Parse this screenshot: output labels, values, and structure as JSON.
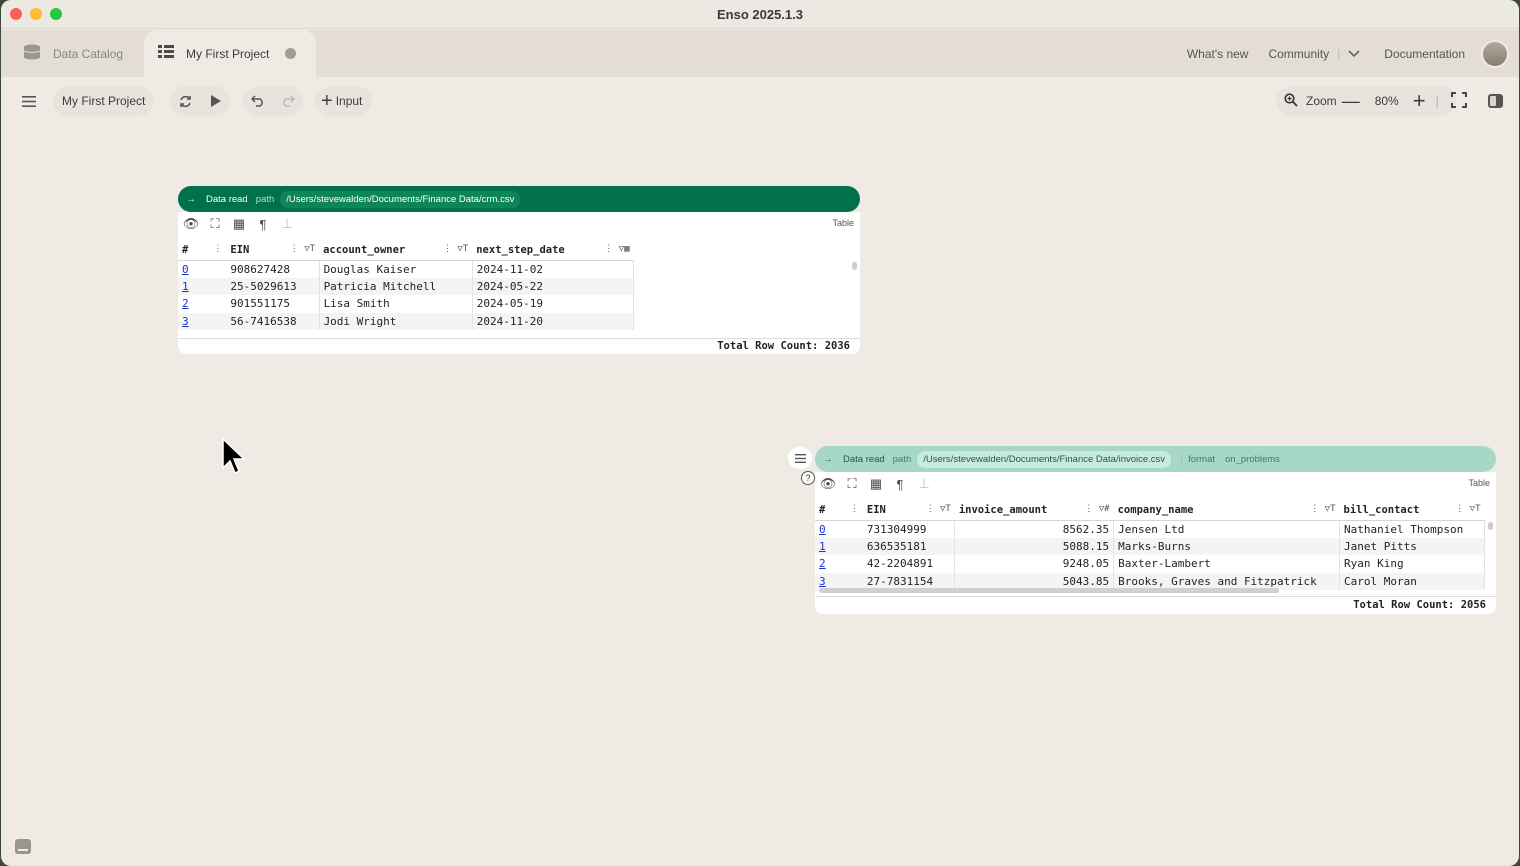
{
  "window": {
    "title": "Enso 2025.1.3"
  },
  "tabs": [
    {
      "label": "Data Catalog",
      "icon": "database-icon"
    },
    {
      "label": "My First Project",
      "icon": "project-table-icon"
    }
  ],
  "nav": {
    "whats_new": "What's new",
    "community": "Community",
    "documentation": "Documentation"
  },
  "toolbar": {
    "project_name": "My First Project",
    "input_label": "Input",
    "zoom_label": "Zoom",
    "zoom_value": "80%"
  },
  "node1": {
    "keyword": "Data read",
    "path_label": "path",
    "path_value": "/Users/stevewalden/Documents/Finance Data/crm.csv",
    "viz_type": "Table",
    "columns": [
      "#",
      "EIN",
      "account_owner",
      "next_step_date"
    ],
    "rows": [
      [
        "0",
        "908627428",
        "Douglas Kaiser",
        "2024-11-02"
      ],
      [
        "1",
        "25-5029613",
        "Patricia Mitchell",
        "2024-05-22"
      ],
      [
        "2",
        "901551175",
        "Lisa Smith",
        "2024-05-19"
      ],
      [
        "3",
        "56-7416538",
        "Jodi Wright",
        "2024-11-20"
      ]
    ],
    "total_row_count": "Total Row Count: 2036"
  },
  "node2": {
    "keyword": "Data read",
    "path_label": "path",
    "path_value": "/Users/stevewalden/Documents/Finance Data/invoice.csv",
    "format_label": "format",
    "on_problems_label": "on_problems",
    "viz_type": "Table",
    "columns": [
      "#",
      "EIN",
      "invoice_amount",
      "company_name",
      "bill_contact"
    ],
    "rows": [
      [
        "0",
        "731304999",
        "8562.35",
        "Jensen Ltd",
        "Nathaniel Thompson"
      ],
      [
        "1",
        "636535181",
        "5088.15",
        "Marks-Burns",
        "Janet Pitts"
      ],
      [
        "2",
        "42-2204891",
        "9248.05",
        "Baxter-Lambert",
        "Ryan King"
      ],
      [
        "3",
        "27-7831154",
        "5043.85",
        "Brooks, Graves and Fitzpatrick",
        "Carol Moran"
      ]
    ],
    "total_row_count": "Total Row Count: 2056"
  },
  "colors": {
    "node1_header": "#00714a",
    "node2_header": "#a7d8c6",
    "canvas": "#efebe4"
  }
}
